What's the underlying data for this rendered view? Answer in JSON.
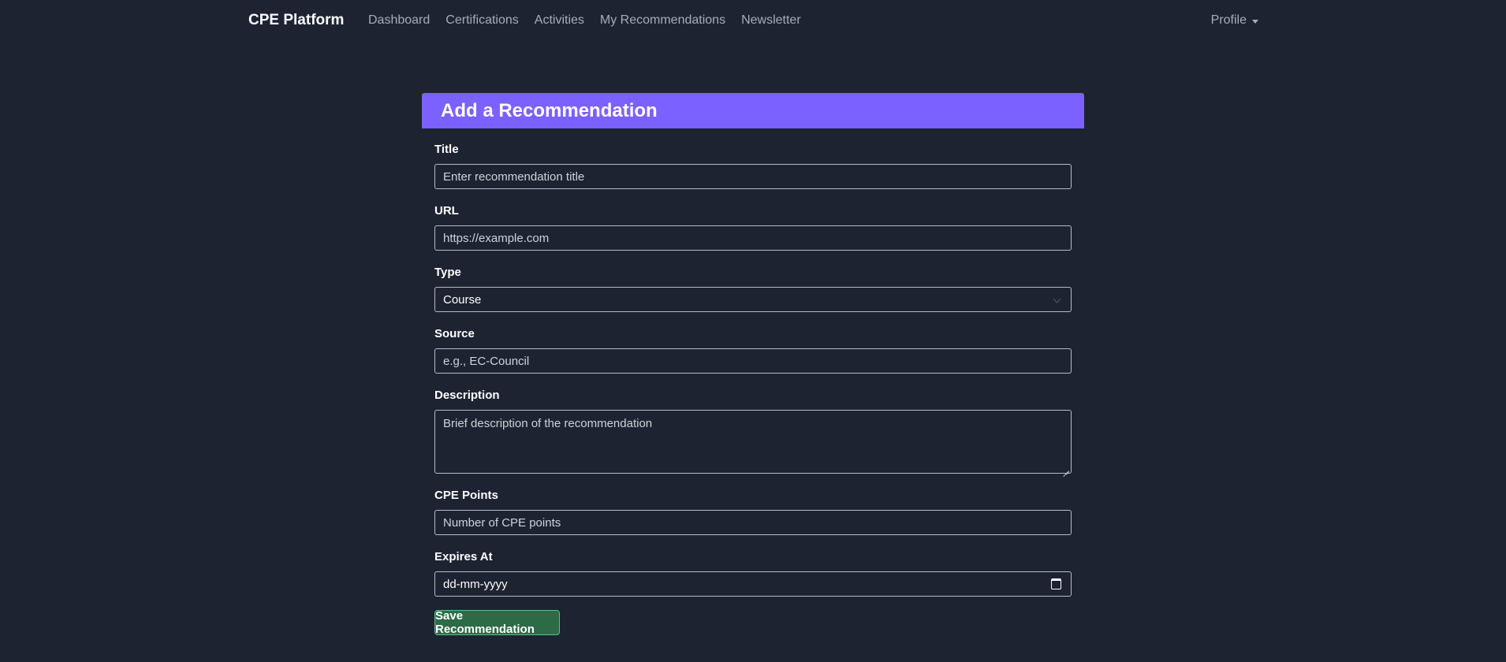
{
  "navbar": {
    "brand": "CPE Platform",
    "links": [
      {
        "label": "Dashboard"
      },
      {
        "label": "Certifications"
      },
      {
        "label": "Activities"
      },
      {
        "label": "My Recommendations"
      },
      {
        "label": "Newsletter"
      }
    ],
    "profile": "Profile"
  },
  "form": {
    "title": "Add a Recommendation",
    "fields": {
      "title": {
        "label": "Title",
        "placeholder": "Enter recommendation title"
      },
      "url": {
        "label": "URL",
        "placeholder": "https://example.com"
      },
      "type": {
        "label": "Type",
        "value": "Course"
      },
      "source": {
        "label": "Source",
        "placeholder": "e.g., EC-Council"
      },
      "description": {
        "label": "Description",
        "placeholder": "Brief description of the recommendation"
      },
      "cpe_points": {
        "label": "CPE Points",
        "placeholder": "Number of CPE points"
      },
      "expires_at": {
        "label": "Expires At",
        "value": "dd-mm-yyyy"
      }
    },
    "submit_label": "Save Recommendation"
  },
  "colors": {
    "background": "#1d2331",
    "header_accent": "#7b61ff",
    "save_button": "#2d6b47",
    "save_button_border": "#5fbf86"
  },
  "icons": {
    "profile_dropdown": "caret-down-icon",
    "type_select": "chevron-down-icon",
    "expires_at": "calendar-icon"
  }
}
